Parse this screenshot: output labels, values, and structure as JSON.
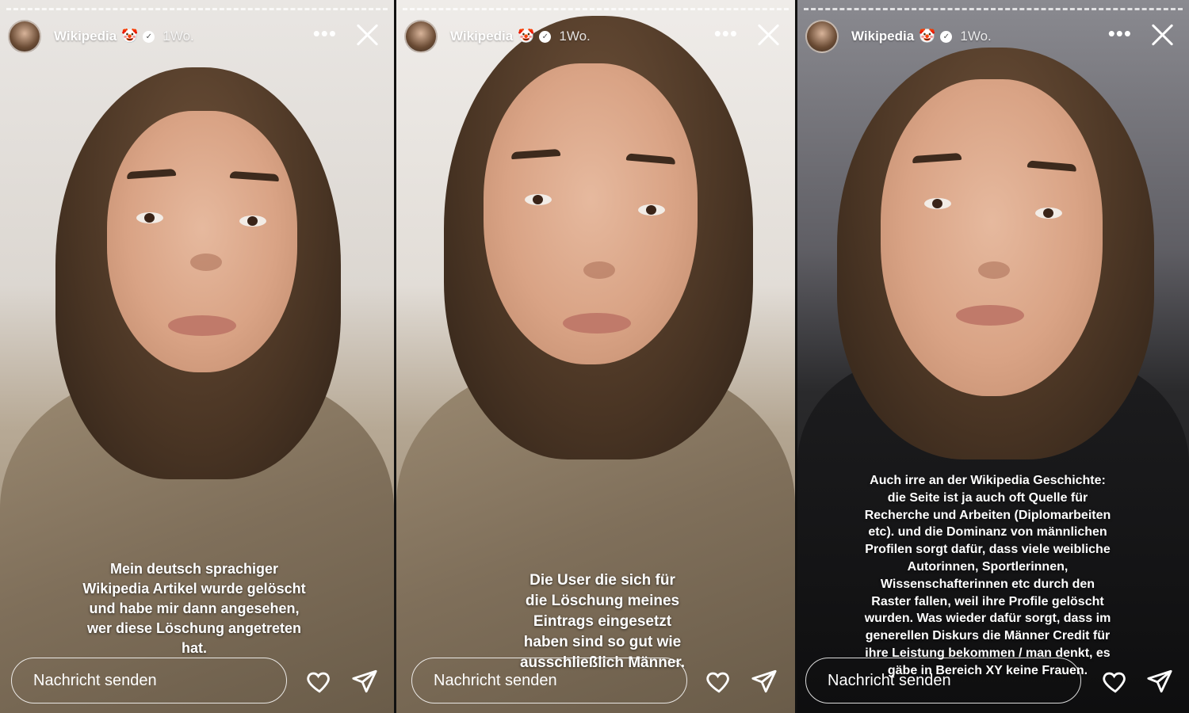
{
  "stories": [
    {
      "username": "Wikipedia",
      "emoji": "🤡",
      "time": "1Wo.",
      "caption": "Mein deutsch sprachiger\nWikipedia Artikel wurde gelöscht\nund habe mir dann angesehen,\nwer diese Löschung angetreten\nhat.",
      "reply_placeholder": "Nachricht senden"
    },
    {
      "username": "Wikipedia",
      "emoji": "🤡",
      "time": "1Wo.",
      "caption": "Die User die sich für\ndie Löschung meines\nEintrags eingesetzt\nhaben sind so gut wie\nausschließlich Männer.",
      "reply_placeholder": "Nachricht senden"
    },
    {
      "username": "Wikipedia",
      "emoji": "🤡",
      "time": "1Wo.",
      "caption": "Auch irre an der Wikipedia Geschichte:\ndie Seite ist ja auch oft Quelle für\nRecherche und Arbeiten (Diplomarbeiten\netc). und die Dominanz von männlichen\nProfilen sorgt dafür, dass viele weibliche\nAutorinnen, Sportlerinnen,\nWissenschafterinnen etc durch den\nRaster fallen, weil ihre Profile gelöscht\nwurden. Was wieder dafür sorgt, dass im\ngenerellen Diskurs die Männer Credit für\nihre Leistung bekommen / man denkt, es\ngäbe in Bereich XY keine Frauen.",
      "reply_placeholder": "Nachricht senden"
    }
  ],
  "icons": {
    "more": "more-horizontal-icon",
    "close": "close-icon",
    "heart": "heart-icon",
    "send": "send-icon",
    "verified": "verified-badge-icon"
  },
  "colors": {
    "text": "#ffffff",
    "verified_badge": "#ffffff"
  }
}
